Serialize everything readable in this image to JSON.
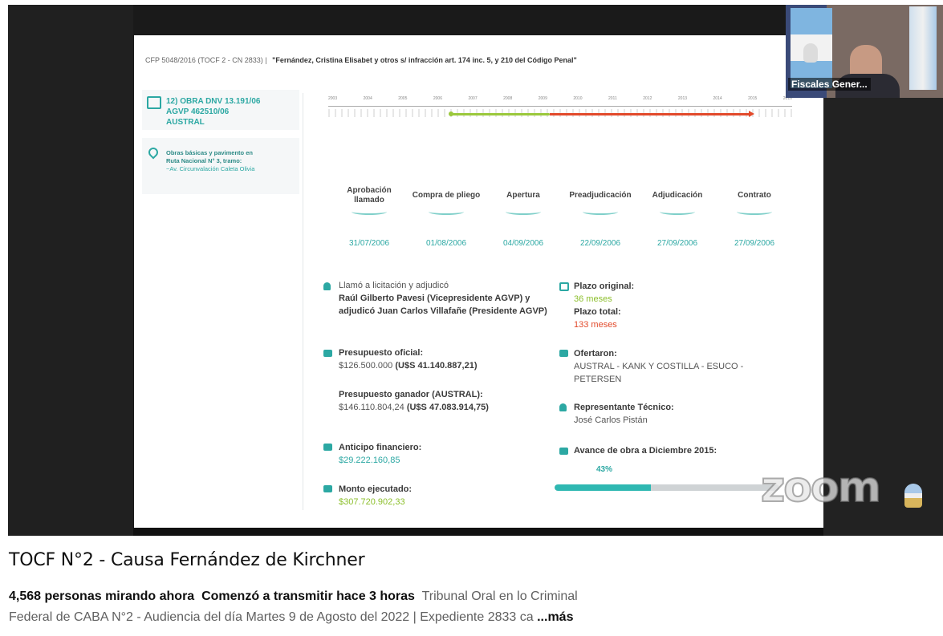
{
  "video": {
    "title": "TOCF N°2 - Causa Fernández de Kirchner",
    "viewers": "4,568 personas mirando ahora",
    "started": "Comenzó a transmitir hace 3 horas",
    "description_line1": "Tribunal Oral en lo Criminal",
    "description_line2": "Federal de CABA N°2 - Audiencia del día Martes 9 de Agosto del 2022 | Expediente 2833 ca",
    "more_label": "...más"
  },
  "webcam": {
    "label": "Fiscales Gener..."
  },
  "watermark": "zoom",
  "slide": {
    "header_case": "CFP 5048/2016 (TOCF 2 - CN 2833) |",
    "header_title": "\"Fernández, Cristina Elisabet y otros s/ infracción art. 174 inc. 5, y 210 del Código Penal\"",
    "obra_line1": "12) OBRA DNV 13.191/06",
    "obra_line2": "AGVP 462510/06",
    "obra_line3": "AUSTRAL",
    "route_line1": "Obras básicas y pavimento en",
    "route_line2": "Ruta Nacional N° 3, tramo:",
    "route_line3": "~Av. Circunvalación Caleta Olivia",
    "timeline_years": [
      "2003",
      "2004",
      "2005",
      "2006",
      "2007",
      "2008",
      "2009",
      "2010",
      "2011",
      "2012",
      "2013",
      "2014",
      "2015",
      "2016"
    ],
    "milestones": [
      {
        "label": "Aprobación llamado",
        "date": "31/07/2006"
      },
      {
        "label": "Compra de pliego",
        "date": "01/08/2006"
      },
      {
        "label": "Apertura",
        "date": "04/09/2006"
      },
      {
        "label": "Preadjudicación",
        "date": "22/09/2006"
      },
      {
        "label": "Adjudicación",
        "date": "27/09/2006"
      },
      {
        "label": "Contrato",
        "date": "27/09/2006"
      }
    ],
    "llamo_label": "Llamó a licitación y adjudicó",
    "llamo_text": "Raúl Gilberto Pavesi (Vicepresidente AGVP) y adjudicó Juan Carlos Villafañe (Presidente AGVP)",
    "presupuesto_oficial_label": "Presupuesto oficial:",
    "presupuesto_oficial_ars": "$126.500.000",
    "presupuesto_oficial_usd": "(U$S 41.140.887,21)",
    "presupuesto_ganador_label": "Presupuesto ganador (AUSTRAL):",
    "presupuesto_ganador_ars": "$146.110.804,24",
    "presupuesto_ganador_usd": "(U$S 47.083.914,75)",
    "anticipo_label": "Anticipo financiero:",
    "anticipo_value": "$29.222.160,85",
    "monto_label": "Monto ejecutado:",
    "monto_value": "$307.720.902,33",
    "plazo_original_label": "Plazo original:",
    "plazo_original_value": "36 meses",
    "plazo_total_label": "Plazo total:",
    "plazo_total_value": "133 meses",
    "ofertaron_label": "Ofertaron:",
    "ofertaron_value": "AUSTRAL - KANK Y COSTILLA - ESUCO - PETERSEN",
    "representante_label": "Representante Técnico:",
    "representante_value": "José Carlos Pistán",
    "avance_label": "Avance de obra a Diciembre 2015:",
    "avance_value": "43%",
    "avance_fraction": 0.43
  },
  "colors": {
    "teal": "#2ca8a3",
    "green": "#8cbf2b",
    "red": "#e24a2b"
  }
}
